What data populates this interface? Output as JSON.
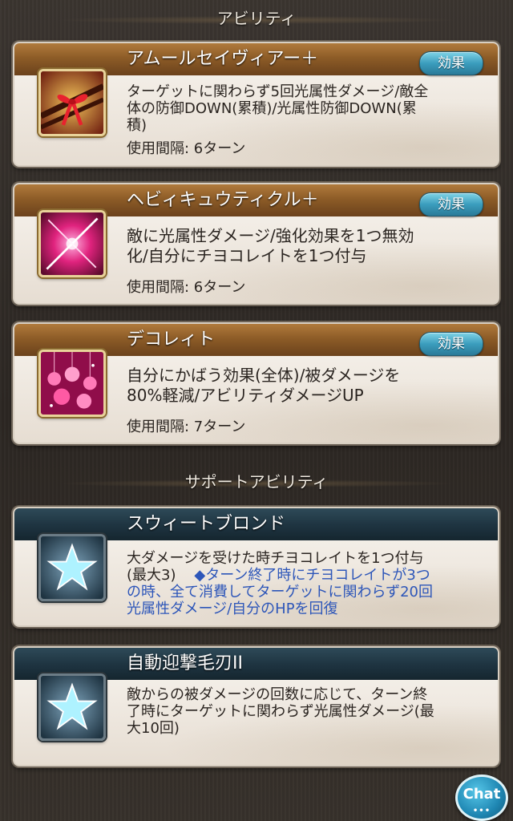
{
  "sections": {
    "ability_header": "アビリティ",
    "support_header": "サポートアビリティ"
  },
  "abilities": [
    {
      "name": "アムールセイヴィアー＋",
      "effect_label": "効果",
      "desc_lines": [
        "ターゲットに関わらず5回光属性ダメージ/敵全",
        "体の防御DOWN(累積)/光属性防御DOWN(累",
        "積)"
      ],
      "cooldown": "使用間隔: 6ターン",
      "icon": "ribbon-gift-icon"
    },
    {
      "name": "ヘビィキュウティクル＋",
      "effect_label": "効果",
      "desc_lines": [
        "敵に光属性ダメージ/強化効果を1つ無効",
        "化/自分にチヨコレイトを1つ付与"
      ],
      "cooldown": "使用間隔: 6ターン",
      "icon": "pink-slash-icon"
    },
    {
      "name": "デコレィト",
      "effect_label": "効果",
      "desc_lines": [
        "自分にかばう効果(全体)/被ダメージを",
        "80%軽減/アビリティダメージUP"
      ],
      "cooldown": "使用間隔: 7ターン",
      "icon": "pink-baubles-icon"
    }
  ],
  "support_abilities": [
    {
      "name": "スウィートブロンド",
      "desc_line1": "大ダメージを受けた時チヨコレイトを1つ付与",
      "desc_line2_plain": "(最大3)",
      "desc_line2_blue": "◆ターン終了時にチヨコレイトが3つ",
      "desc_blue_lines": [
        "の時、全て消費してターゲットに関わらず20回",
        "光属性ダメージ/自分のHPを回復"
      ],
      "icon": "star-icon"
    },
    {
      "name": "自動迎撃毛刃II",
      "desc_lines": [
        "敵からの被ダメージの回数に応じて、ターン終",
        "了時にターゲットに関わらず光属性ダメージ(最",
        "大10回)"
      ],
      "icon": "star-icon"
    }
  ],
  "chat": {
    "label": "Chat",
    "dots": "•••"
  },
  "colors": {
    "ability_bar": "#8d5c27",
    "support_bar": "#1f3542",
    "effect_button": "#3b9dbd",
    "highlight_text": "#2d56b9"
  }
}
